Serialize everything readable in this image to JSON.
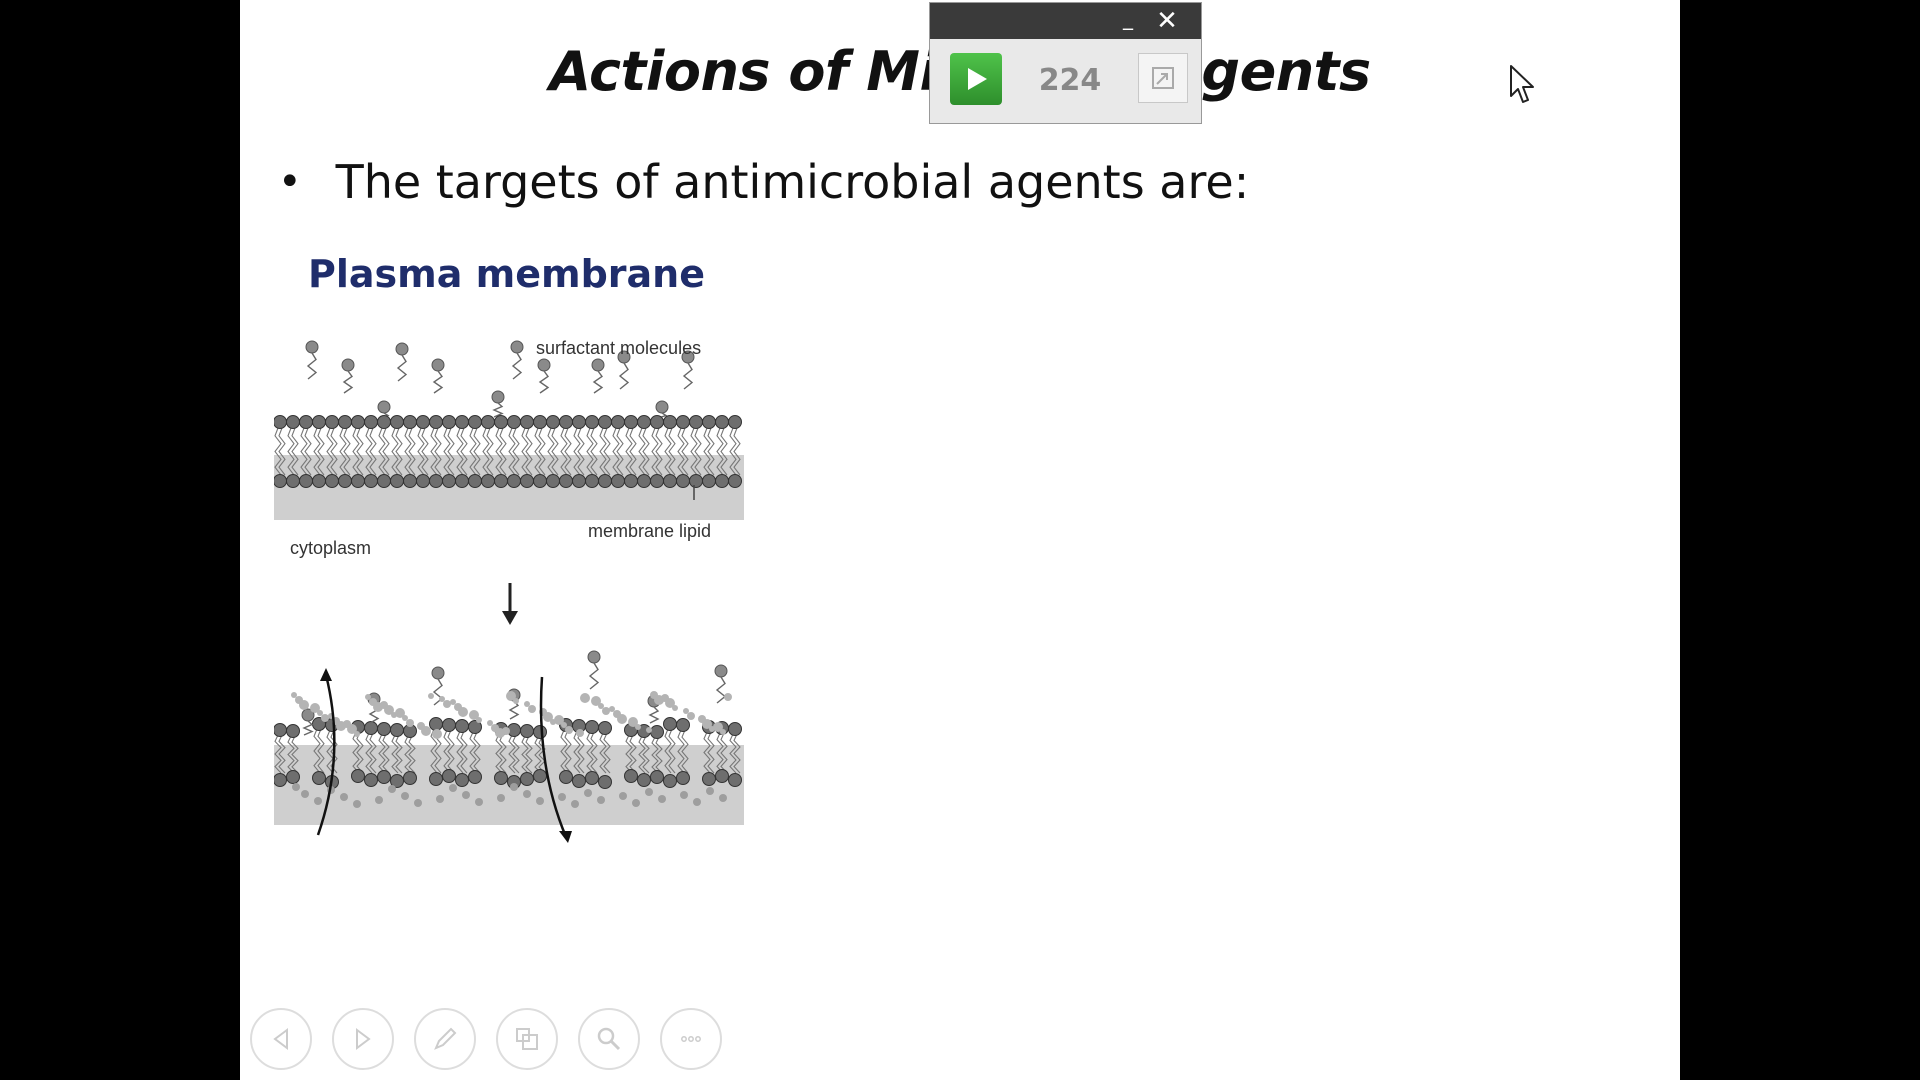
{
  "slide": {
    "title": "Actions of Microbial Agents",
    "bullet": "The targets of antimicrobial agents are:",
    "subheading": "Plasma membrane",
    "figure": {
      "label_surfactant": "surfactant molecules",
      "label_membrane_lipid": "membrane lipid",
      "label_cytoplasm": "cytoplasm"
    }
  },
  "controls": [
    {
      "name": "previous",
      "icon": "left-triangle-icon"
    },
    {
      "name": "next",
      "icon": "right-triangle-icon"
    },
    {
      "name": "pen",
      "icon": "pen-icon"
    },
    {
      "name": "slides",
      "icon": "grid-icon"
    },
    {
      "name": "zoom",
      "icon": "magnifier-icon"
    },
    {
      "name": "more",
      "icon": "ellipsis-icon"
    }
  ],
  "timer_widget": {
    "count": "224",
    "minimize_label": "_",
    "close_label": "✕"
  },
  "colors": {
    "subheading": "#1f2d6b",
    "play_green": "#3aa837",
    "background": "#000000"
  }
}
